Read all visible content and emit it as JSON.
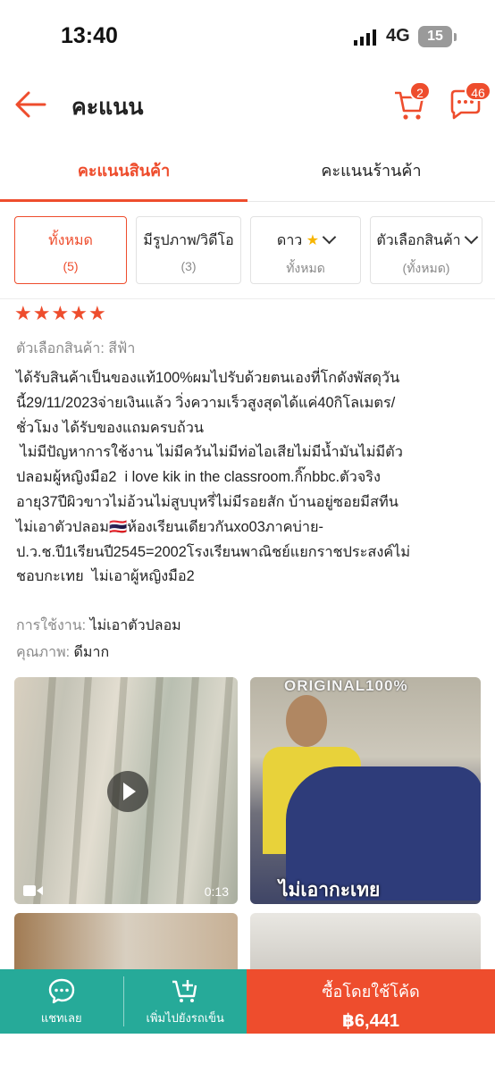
{
  "status_bar": {
    "time": "13:40",
    "network": "4G",
    "battery": "15"
  },
  "header": {
    "title": "คะแนน",
    "cart_badge": "2",
    "chat_badge": "46"
  },
  "tabs": [
    {
      "label": "คะแนนสินค้า",
      "active": true
    },
    {
      "label": "คะแนนร้านค้า",
      "active": false
    }
  ],
  "filters": [
    {
      "label": "ทั้งหมด",
      "sub": "(5)",
      "active": true
    },
    {
      "label": "มีรูปภาพ/วิดีโอ",
      "sub": "(3)",
      "active": false
    },
    {
      "label": "ดาว",
      "sub": "ทั้งหมด",
      "active": false
    },
    {
      "label": "ตัวเลือกสินค้า",
      "sub": "(ทั้งหมด)",
      "active": false
    }
  ],
  "review": {
    "rating": 5,
    "variant_label": "ตัวเลือกสินค้า: สีฟ้า",
    "lines": [
      "ได้รับสินค้าเป็นของแท้100%ผมไปรับด้วยตนเองที่โกดังพัสดุวัน",
      "นี้29/11/2023จ่ายเงินแล้ว วิ่งความเร็วสูงสุดได้แค่40กิโลเมตร/",
      "ชั่วโมง ได้รับของแถมครบถ้วน",
      " ไม่มีปัญหาการใช้งาน ไม่มีควันไม่มีท่อไอเสียไม่มีน้ำมันไม่มีตัว",
      "ปลอมผู้หญิงมือ2  i love kik in the classroom.กิ๊กbbc.ตัวจริง",
      "อายุ37ปีผิวขาวไม่อ้วนไม่สูบบุหรี่ไม่มีรอยสัก บ้านอยู่ซอยมีสทีน",
      "ไม่เอาตัวปลอม🇹🇭ห้องเรียนเดียวกันxo03ภาคบ่าย-",
      "ป.ว.ช.ปี1เรียนปี2545=2002โรงเรียนพาณิชย์แยกราชประสงค์ไม่",
      "ชอบกะเทย  ไม่เอาผู้หญิงมือ2"
    ],
    "usage_label": "การใช้งาน:",
    "usage_value": "ไม่เอาตัวปลอม",
    "quality_label": "คุณภาพ:",
    "quality_value": "ดีมาก",
    "video_duration": "0:13",
    "photo_caption_top": "ORIGINAL100%",
    "photo_caption_bottom": "ไม่เอากะเทย"
  },
  "bottom_bar": {
    "chat_label": "แชทเลย",
    "add_cart_label": "เพิ่มไปยังรถเข็น",
    "buy_label": "ซื้อโดยใช้โค้ด",
    "price": "฿6,441"
  },
  "colors": {
    "accent": "#ee4d2d",
    "teal": "#26aa99"
  },
  "icons": [
    "back-arrow-icon",
    "cart-icon",
    "chat-icon",
    "star-icon",
    "chevron-down-icon",
    "play-icon",
    "video-camera-icon",
    "add-cart-icon"
  ]
}
